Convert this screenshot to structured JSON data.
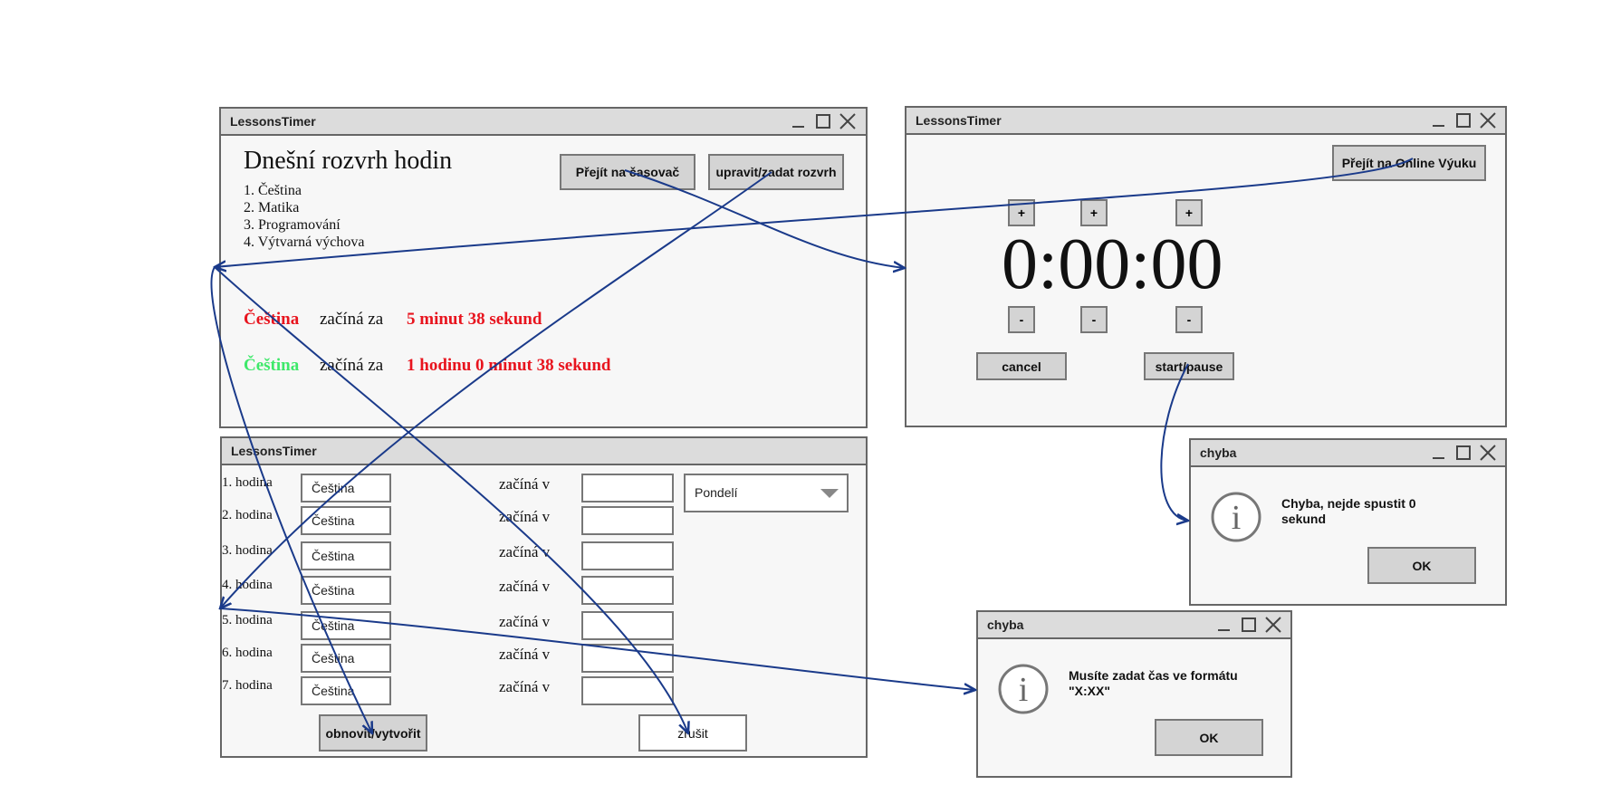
{
  "main_window": {
    "title": "LessonsTimer",
    "heading": "Dnešní rozvrh hodin",
    "schedule": [
      "1. Čeština",
      "2. Matika",
      "3. Programování",
      "4. Výtvarná výchova"
    ],
    "goto_timer_button": "Přejít na časovač",
    "edit_schedule_button": "upravit/zadat rozvrh",
    "next_lessons": [
      {
        "subject": "Čeština",
        "subject_color": "#e8141e",
        "middle": "začíná za",
        "time": "5 minut 38 sekund",
        "time_color": "#e8141e"
      },
      {
        "subject": "Čeština",
        "subject_color": "#3ee86a",
        "middle": "začíná za",
        "time": "1 hodinu 0 minut 38 sekund",
        "time_color": "#e8141e"
      }
    ]
  },
  "timer_window": {
    "title": "LessonsTimer",
    "online_button": "Přejít na Online Výuku",
    "display": "0:00:00",
    "plus_label": "+",
    "minus_label": "-",
    "cancel_button": "cancel",
    "start_pause_button": "start/pause"
  },
  "schedule_window": {
    "title": "LessonsTimer",
    "rows": [
      {
        "label": "1. hodina",
        "subject": "Čeština",
        "starts": "začíná v",
        "time": ""
      },
      {
        "label": "2. hodina",
        "subject": "Čeština",
        "starts": "začíná v",
        "time": ""
      },
      {
        "label": "3. hodina",
        "subject": "Čeština",
        "starts": "začíná v",
        "time": ""
      },
      {
        "label": "4. hodina",
        "subject": "Čeština",
        "starts": "začíná v",
        "time": ""
      },
      {
        "label": "5. hodina",
        "subject": "Čeština",
        "starts": "začíná v",
        "time": ""
      },
      {
        "label": "6. hodina",
        "subject": "Čeština",
        "starts": "začíná v",
        "time": ""
      },
      {
        "label": "7. hodina",
        "subject": "Čeština",
        "starts": "začíná v",
        "time": ""
      }
    ],
    "day_select": "Pondelí",
    "refresh_button": "obnovit/vytvořit",
    "cancel_button": "zrušit"
  },
  "error_dialog_1": {
    "title": "chyba",
    "message": "Chyba, nejde spustit 0 sekund",
    "ok": "OK"
  },
  "error_dialog_2": {
    "title": "chyba",
    "message": "Musíte zadat čas ve formátu \"X:XX\"",
    "ok": "OK"
  },
  "colors": {
    "connector": "#1a3a8a",
    "window_bg": "#f7f7f7",
    "titlebar": "#dcdcdc",
    "border": "#666666"
  }
}
